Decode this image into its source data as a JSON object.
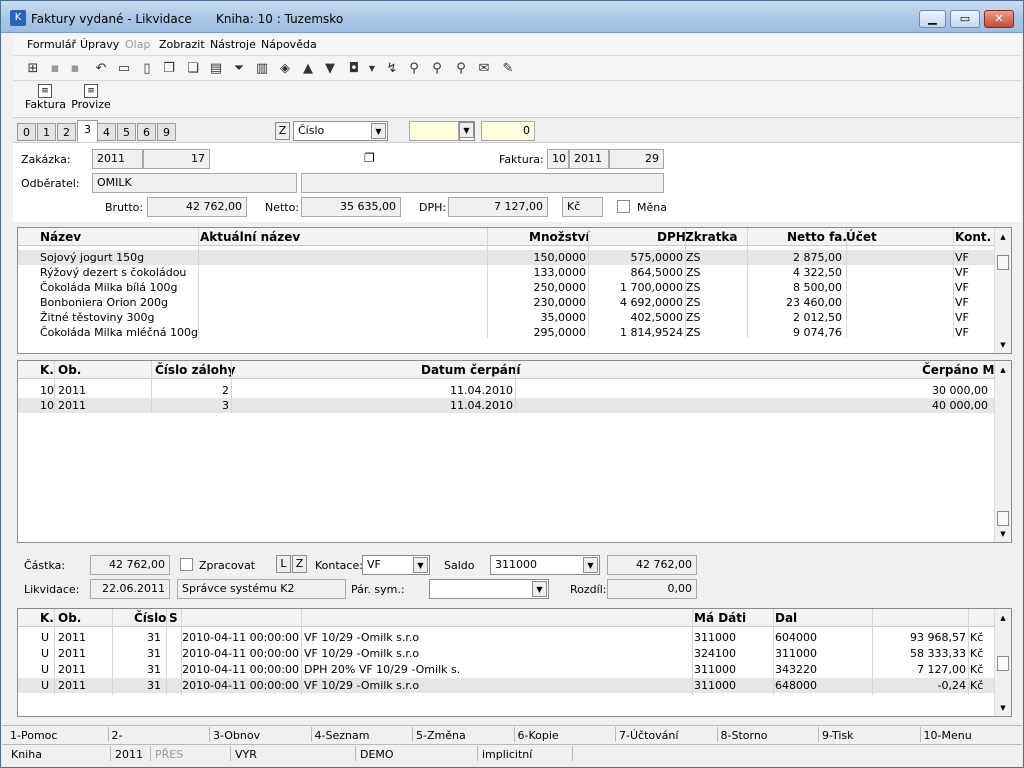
{
  "window": {
    "title": "Faktury vydané - Likvidace",
    "subtitle": "Kniha: 10 : Tuzemsko",
    "min": "▁",
    "max": "▭",
    "close": "✕"
  },
  "menu": [
    "Formulář",
    "Úpravy",
    "Olap",
    "Zobrazit",
    "Nástroje",
    "Nápověda"
  ],
  "toolbar2": {
    "faktura": "Faktura",
    "provize": "Provize"
  },
  "tabs": [
    "0",
    "1",
    "2",
    "3",
    "4",
    "5",
    "6",
    "9"
  ],
  "filter": {
    "z": "Z",
    "sort": "Číslo",
    "value": "0"
  },
  "header": {
    "zakazka_label": "Zakázka:",
    "zakazka_year": "2011",
    "zakazka_num": "17",
    "faktura_label": "Faktura:",
    "faktura_book": "10",
    "faktura_year": "2011",
    "faktura_num": "29",
    "odberatel_label": "Odběratel:",
    "odberatel": "OMILK",
    "brutto_label": "Brutto:",
    "brutto": "42 762,00",
    "netto_label": "Netto:",
    "netto": "35 635,00",
    "dph_label": "DPH:",
    "dph": "7 127,00",
    "currency": "Kč",
    "mena_label": "Měna"
  },
  "items": {
    "columns": [
      "Název",
      "Aktuální název",
      "Množství",
      "DPH",
      "Zkratka",
      "Netto fa.",
      "Účet",
      "Kont."
    ],
    "rows": [
      [
        "Sojový jogurt 150g",
        "",
        "150,0000",
        "575,0000",
        "ZS",
        "2 875,00",
        "",
        "VF"
      ],
      [
        "Rýžový dezert s čokoládou",
        "",
        "133,0000",
        "864,5000",
        "ZS",
        "4 322,50",
        "",
        "VF"
      ],
      [
        "Čokoláda Milka bílá 100g",
        "",
        "250,0000",
        "1 700,0000",
        "ZS",
        "8 500,00",
        "",
        "VF"
      ],
      [
        "Bonboniera Orion 200g",
        "",
        "230,0000",
        "4 692,0000",
        "ZS",
        "23 460,00",
        "",
        "VF"
      ],
      [
        "Žitné těstoviny 300g",
        "",
        "35,0000",
        "402,5000",
        "ZS",
        "2 012,50",
        "",
        "VF"
      ],
      [
        "Čokoláda Milka mléčná 100g",
        "",
        "295,0000",
        "1 814,9524",
        "ZS",
        "9 074,76",
        "",
        "VF"
      ]
    ]
  },
  "advances": {
    "columns": [
      "K.",
      "Ob.",
      "Číslo zálohy",
      "Datum čerpání",
      "Čerpáno M"
    ],
    "rows": [
      [
        "10",
        "2011",
        "2",
        "11.04.2010",
        "30 000,00"
      ],
      [
        "10",
        "2011",
        "3",
        "11.04.2010",
        "40 000,00"
      ]
    ]
  },
  "liquid": {
    "castka_label": "Částka:",
    "castka": "42 762,00",
    "zpracovat_label": "Zpracovat",
    "l": "L",
    "z": "Z",
    "kontace_label": "Kontace:",
    "kontace": "VF",
    "saldo_label": "Saldo",
    "saldo": "311000",
    "saldo_val": "42 762,00",
    "likvidace_label": "Likvidace:",
    "likvidace_date": "22.06.2011",
    "likvidace_user": "Správce systému K2",
    "parsym_label": "Pár. sym.:",
    "parsym": "",
    "rozdil_label": "Rozdíl:",
    "rozdil": "0,00"
  },
  "entries": {
    "columns": [
      "K.",
      "Ob.",
      "Číslo",
      "S",
      "",
      "",
      "Má Dáti",
      "Dal",
      "",
      ""
    ],
    "rows": [
      [
        "U",
        "2011",
        "31",
        "",
        "2010-04-11 00:00:00",
        "VF 10/29      -Omilk s.r.o",
        "311000",
        "604000",
        "93 968,57",
        "Kč"
      ],
      [
        "U",
        "2011",
        "31",
        "",
        "2010-04-11 00:00:00",
        "VF 10/29      -Omilk s.r.o",
        "324100",
        "311000",
        "58 333,33",
        "Kč"
      ],
      [
        "U",
        "2011",
        "31",
        "",
        "2010-04-11 00:00:00",
        "DPH 20% VF 10/29      -Omilk s.",
        "311000",
        "343220",
        "7 127,00",
        "Kč"
      ],
      [
        "U",
        "2011",
        "31",
        "",
        "2010-04-11 00:00:00",
        "VF 10/29      -Omilk s.r.o",
        "311000",
        "648000",
        "-0,24",
        "Kč"
      ]
    ]
  },
  "fkeys": [
    "1-Pomoc",
    "2-",
    "3-Obnov",
    "4-Seznam",
    "5-Změna",
    "6-Kopie",
    "7-Účtování",
    "8-Storno",
    "9-Tisk",
    "10-Menu"
  ],
  "statusbar": [
    "Kniha",
    "2011",
    "PŘES",
    "VYR",
    "DEMO",
    "implicitní"
  ]
}
